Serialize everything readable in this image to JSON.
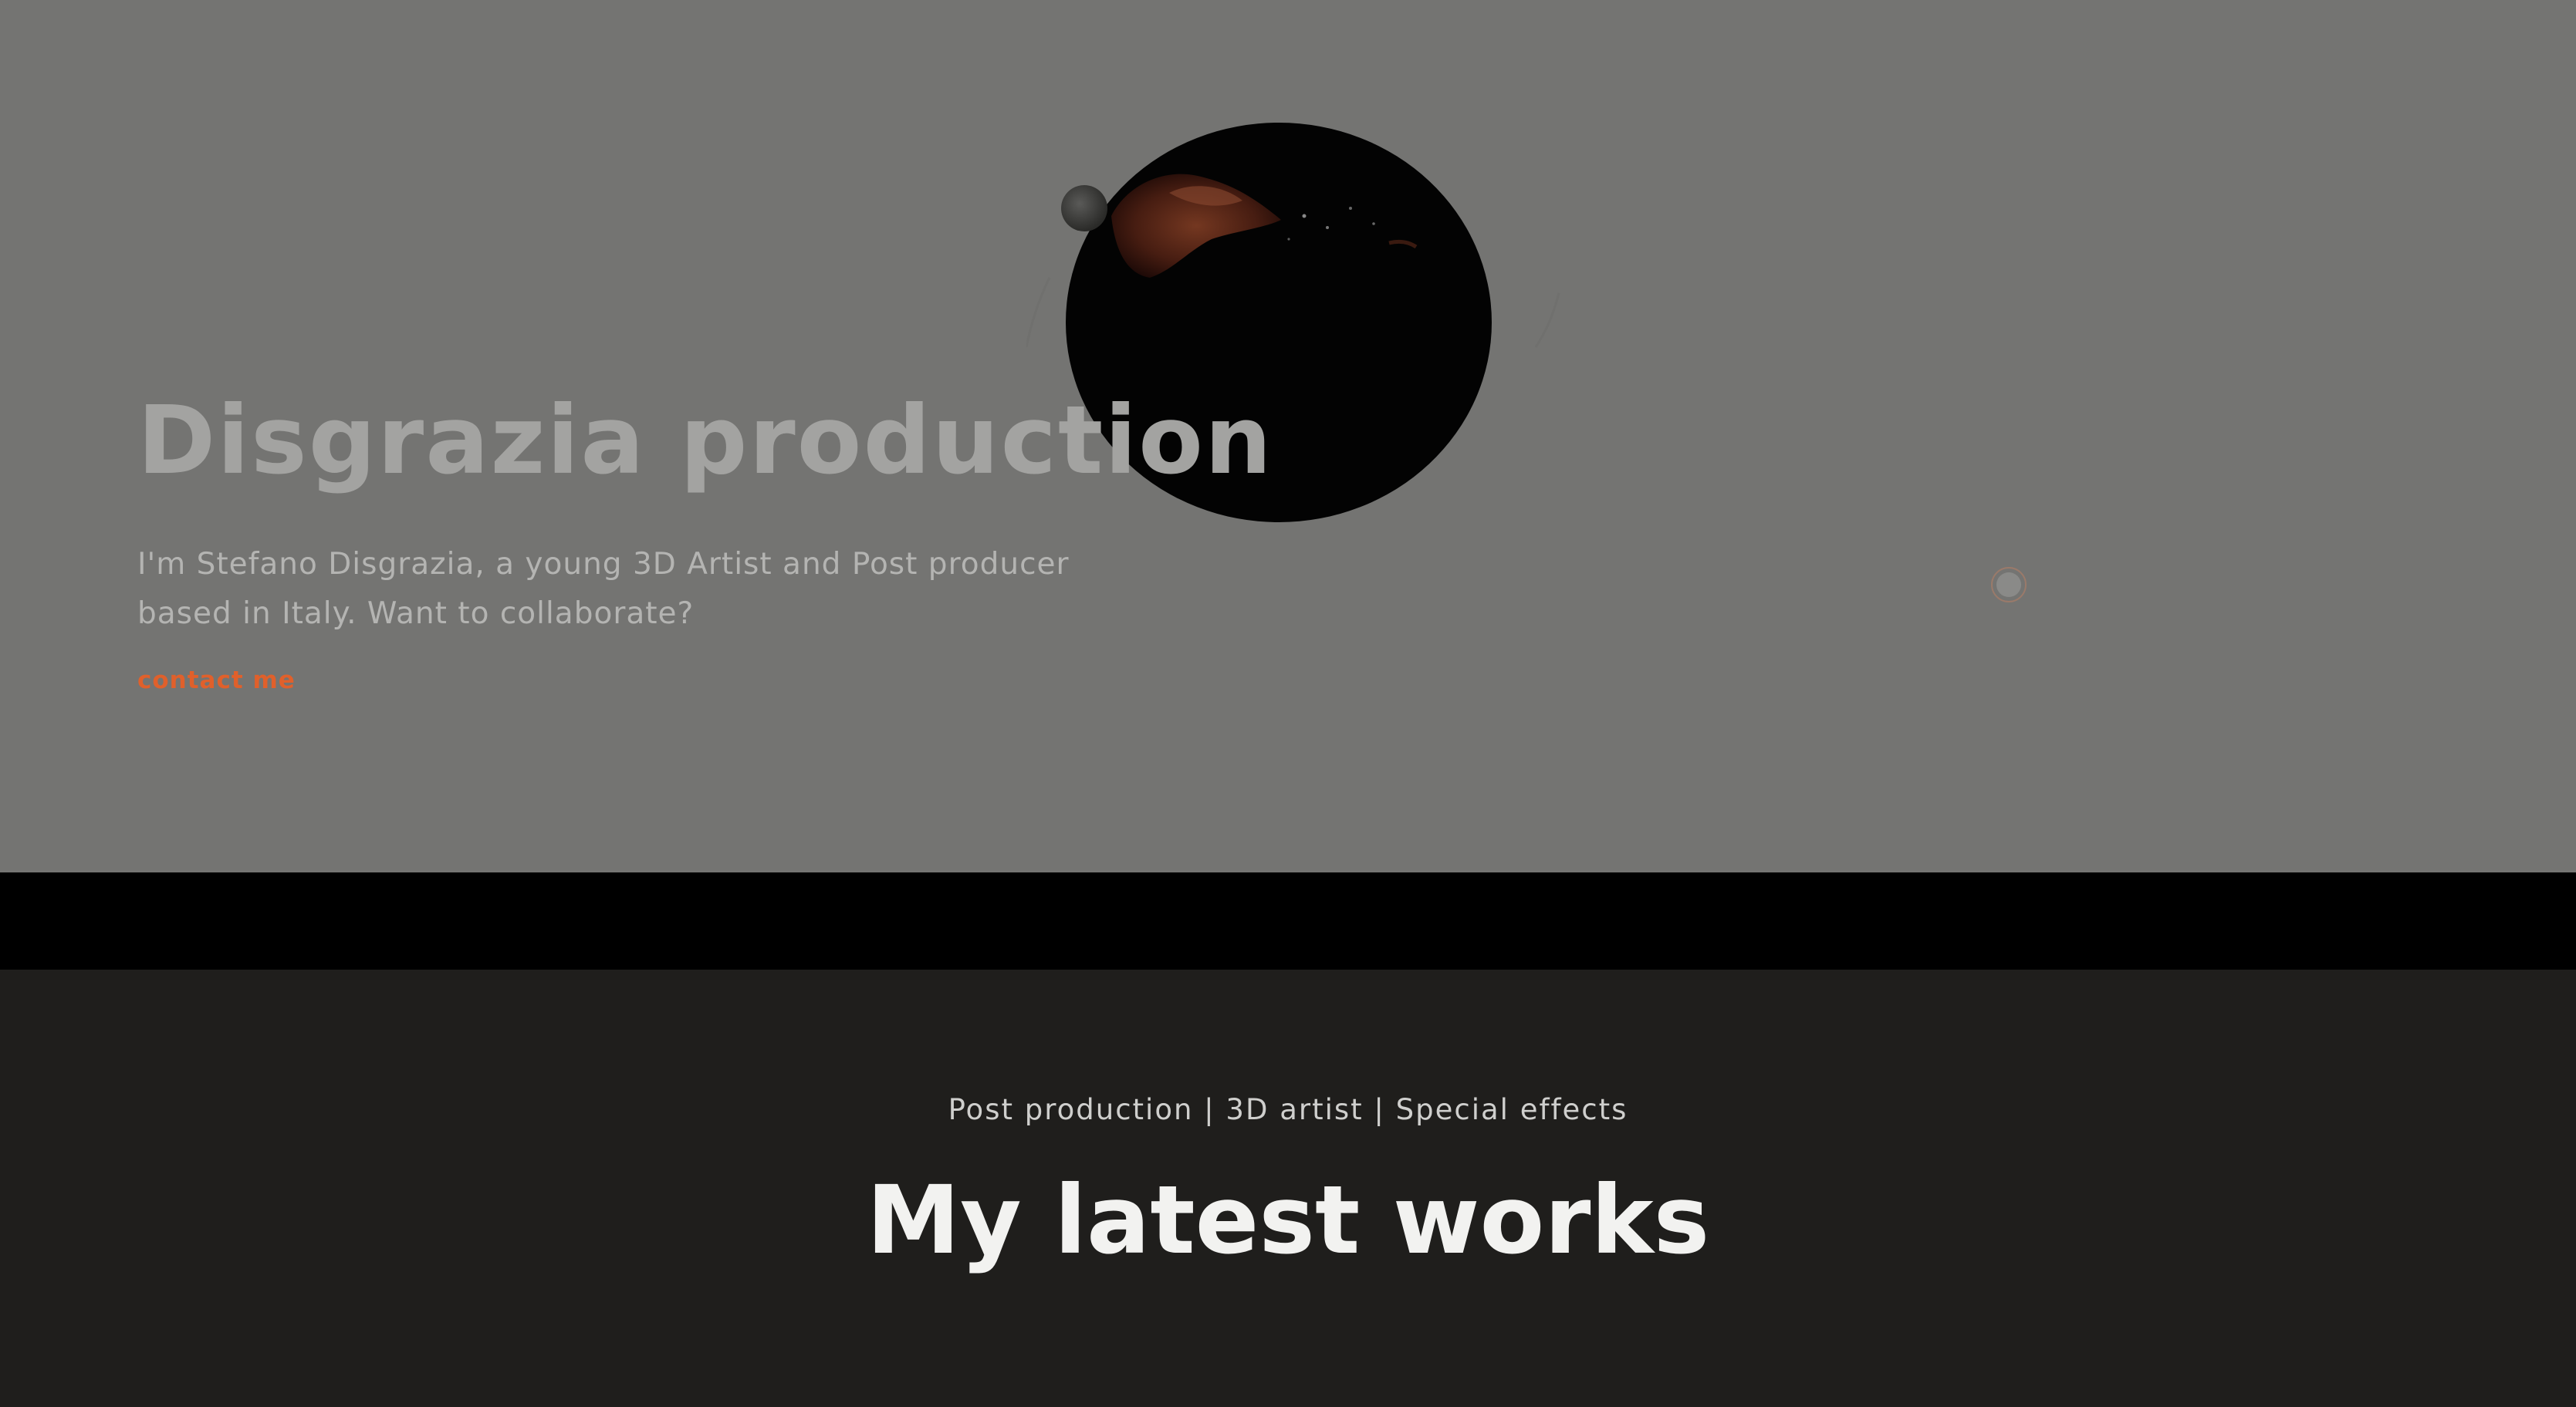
{
  "hero": {
    "title": "Disgrazia production",
    "subtitle": "I'm Stefano Disgrazia, a young 3D Artist and Post producer based in Italy. Want to collaborate?",
    "cta_label": "contact me",
    "visual_icon": "dark-sphere-with-liquid-splash",
    "cursor_icon": "custom-cursor-ring"
  },
  "works": {
    "tagline": "Post production | 3D artist | Special effects",
    "title": "My latest works"
  },
  "colors": {
    "hero_background": "#747472",
    "band": "#000000",
    "works_background": "#1f1e1c",
    "accent": "#e0602b",
    "hero_title": "#a3a3a1",
    "works_title": "#f2f2f0"
  }
}
